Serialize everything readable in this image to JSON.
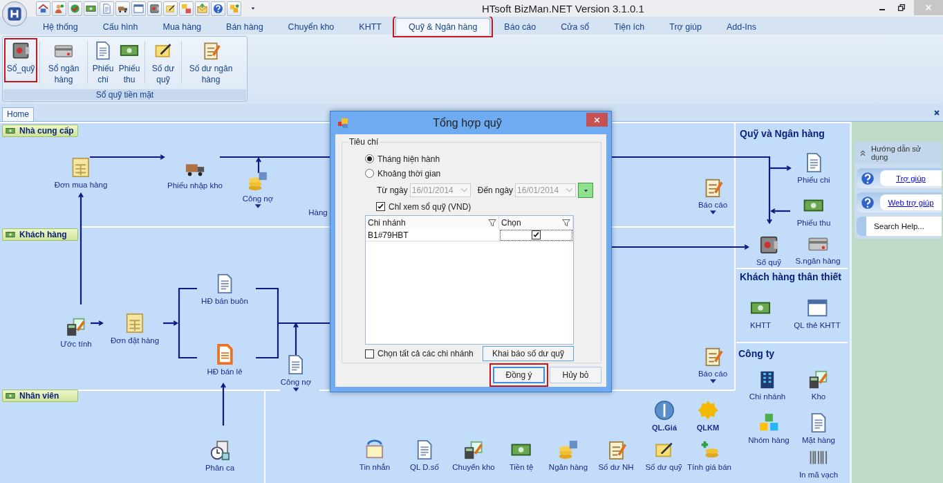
{
  "window": {
    "title": "HTsoft BizMan.NET Version 3.1.0.1"
  },
  "menu_tabs": [
    {
      "label": "Hệ thống",
      "selected": false,
      "highlighted": false
    },
    {
      "label": "Cấu hình",
      "selected": false,
      "highlighted": false
    },
    {
      "label": "Mua hàng",
      "selected": false,
      "highlighted": false
    },
    {
      "label": "Bán hàng",
      "selected": false,
      "highlighted": false
    },
    {
      "label": "Chuyển kho",
      "selected": false,
      "highlighted": false
    },
    {
      "label": "KHTT",
      "selected": false,
      "highlighted": false
    },
    {
      "label": "Quỹ & Ngân hàng",
      "selected": true,
      "highlighted": true
    },
    {
      "label": "Báo cáo",
      "selected": false,
      "highlighted": false
    },
    {
      "label": "Cửa sổ",
      "selected": false,
      "highlighted": false
    },
    {
      "label": "Tiện ích",
      "selected": false,
      "highlighted": false
    },
    {
      "label": "Trợ giúp",
      "selected": false,
      "highlighted": false
    },
    {
      "label": "Add-Ins",
      "selected": false,
      "highlighted": false
    }
  ],
  "ribbon": {
    "group_label": "Sổ quỹ tiền mặt",
    "buttons": [
      {
        "label": "Sổ_quỹ",
        "highlighted": true
      },
      {
        "label": "Sổ ngân hàng",
        "highlighted": false
      },
      {
        "label": "Phiếu chi",
        "highlighted": false
      },
      {
        "label": "Phiếu thu",
        "highlighted": false
      },
      {
        "label": "Số dư quỹ",
        "highlighted": false
      },
      {
        "label": "Số dư ngân hàng",
        "highlighted": false
      }
    ]
  },
  "document_tabs": [
    {
      "label": "Home",
      "selected": true
    }
  ],
  "flow": {
    "lanes": [
      "Nhà cung cấp",
      "Khách hàng",
      "Nhân viên"
    ],
    "nodes": [
      {
        "label": "Đơn mua hàng",
        "dropdown": false
      },
      {
        "label": "Phiếu nhập kho",
        "dropdown": false
      },
      {
        "label": "Công nợ",
        "dropdown": true
      },
      {
        "label": "Hàng",
        "dropdown": false
      },
      {
        "label": "Báo cáo",
        "dropdown": true
      },
      {
        "label": "Ước tính",
        "dropdown": false
      },
      {
        "label": "Đơn đặt hàng",
        "dropdown": false
      },
      {
        "label": "HĐ bán buôn",
        "dropdown": false
      },
      {
        "label": "HĐ bán lẻ",
        "dropdown": false
      },
      {
        "label": "Công nợ",
        "dropdown": true
      },
      {
        "label": "Báo cáo",
        "dropdown": true
      },
      {
        "label": "Phân ca",
        "dropdown": false
      }
    ],
    "promo_items": [
      "QL.Giá",
      "QLKM"
    ],
    "shortcuts": [
      "Tin nhắn",
      "QL D.số",
      "Chuyển kho",
      "Tiền tệ",
      "Ngân hàng",
      "Số dư NH",
      "Số dư quỹ",
      "Tính giá bán"
    ]
  },
  "side_sections": [
    {
      "heading": "Quỹ và Ngân hàng",
      "items": [
        "Phiếu chi",
        "Phiếu thu",
        "Sổ quỹ",
        "S.ngân hàng"
      ]
    },
    {
      "heading": "Khách hàng thân thiết",
      "items": [
        "KHTT",
        "QL thẻ KHTT"
      ]
    },
    {
      "heading": "Công ty",
      "items": [
        "Chi nhánh",
        "Kho",
        "Nhóm hàng",
        "Mặt hàng",
        "In mã vạch"
      ]
    }
  ],
  "help_panel": {
    "title": "Hướng dẫn sử dụng",
    "links": [
      "Trợ giúp",
      "Web trợ giúp"
    ],
    "search_button": "Search Help..."
  },
  "dialog": {
    "title": "Tổng hợp quỹ",
    "group_label": "Tiêu chí",
    "period_options": [
      {
        "label": "Tháng hiện hành",
        "selected": true
      },
      {
        "label": "Khoảng thời gian",
        "selected": false
      }
    ],
    "from_date": {
      "label": "Từ ngày",
      "value": "16/01/2014",
      "disabled": true
    },
    "to_date": {
      "label": "Đến ngày",
      "value": "16/01/2014",
      "disabled": true
    },
    "fund_only": {
      "label": "Chỉ xem sổ quỹ (VND)",
      "checked": true
    },
    "grid": {
      "columns": [
        "Chi nhánh",
        "Chọn"
      ],
      "rows": [
        {
          "branch": "B1#79HBT",
          "checked": true
        }
      ]
    },
    "select_all": {
      "label": "Chọn tất cả các chi nhánh",
      "checked": false
    },
    "declare_button": "Khai báo số dư quỹ",
    "buttons": [
      {
        "label": "Đồng ý",
        "highlighted": true
      },
      {
        "label": "Hủy bỏ",
        "highlighted": false
      }
    ]
  }
}
